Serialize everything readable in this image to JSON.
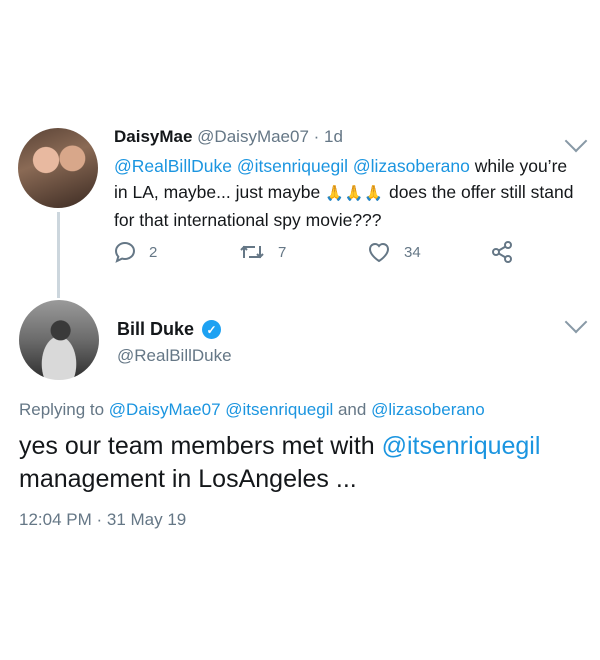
{
  "tweet1": {
    "display_name": "DaisyMae",
    "handle": "@DaisyMae07",
    "separator": " · ",
    "age": "1d",
    "text_parts": {
      "m1": "@RealBillDuke",
      "m2": "@itsenriquegil",
      "m3": "@lizasoberano",
      "t1": " while you’re in LA, maybe... just maybe ",
      "emoji": "🙏🙏🙏",
      "t2": " does the offer still stand for that international spy movie???"
    },
    "actions": {
      "replies": "2",
      "retweets": "7",
      "likes": "34"
    }
  },
  "tweet2": {
    "display_name": "Bill Duke",
    "handle": "@RealBillDuke",
    "replying_prefix": "Replying to ",
    "replying_1": "@DaisyMae07",
    "replying_2": "@itsenriquegil",
    "replying_and": " and ",
    "replying_3": "@lizasoberano",
    "text_a": "yes our team members met with ",
    "text_mention": "@itsenriquegil",
    "text_b": " management in LosAngeles ...",
    "timestamp": "12:04 PM · 31 May 19"
  },
  "icons": [
    "reply-icon",
    "retweet-icon",
    "like-icon",
    "share-icon",
    "chevron-down-icon",
    "verified-icon"
  ],
  "colors": {
    "link": "#1b95e0",
    "muted": "#657786",
    "verified": "#1da1f2"
  }
}
